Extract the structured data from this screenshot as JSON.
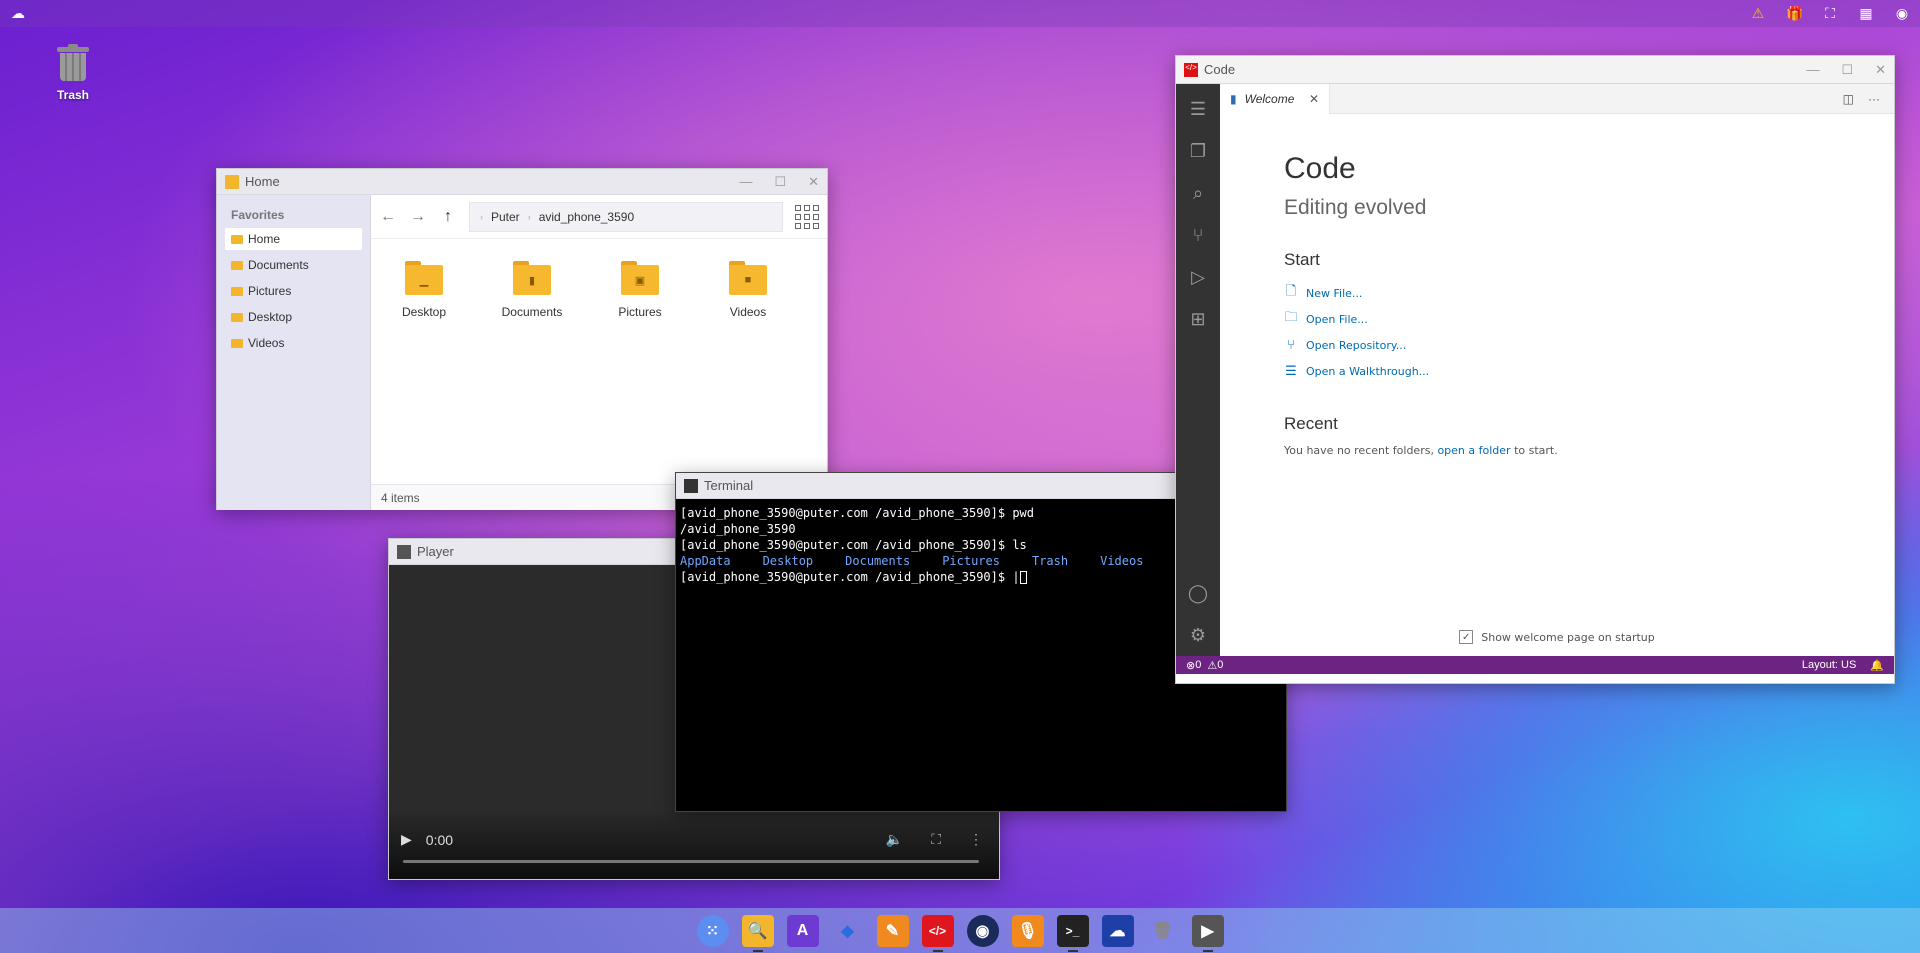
{
  "topbar": {
    "icons": [
      "puter-logo-icon",
      "warning-icon",
      "gift-icon",
      "fullscreen-icon",
      "qr-icon",
      "user-icon"
    ]
  },
  "desktop": {
    "trash_label": "Trash"
  },
  "home": {
    "title": "Home",
    "favorites_heading": "Favorites",
    "sidebar": [
      {
        "label": "Home"
      },
      {
        "label": "Documents"
      },
      {
        "label": "Pictures"
      },
      {
        "label": "Desktop"
      },
      {
        "label": "Videos"
      }
    ],
    "path": [
      "Puter",
      "avid_phone_3590"
    ],
    "files": [
      {
        "label": "Desktop"
      },
      {
        "label": "Documents"
      },
      {
        "label": "Pictures"
      },
      {
        "label": "Videos"
      }
    ],
    "status": "4 items"
  },
  "player": {
    "title": "Player",
    "time": "0:00",
    "progress": 0
  },
  "terminal": {
    "title": "Terminal",
    "lines": [
      "[avid_phone_3590@puter.com /avid_phone_3590]$ pwd",
      "/avid_phone_3590",
      "[avid_phone_3590@puter.com /avid_phone_3590]$ ls"
    ],
    "ls_items": [
      "AppData",
      "Desktop",
      "Documents",
      "Pictures",
      "Trash",
      "Videos"
    ],
    "prompt": "[avid_phone_3590@puter.com /avid_phone_3590]$ |"
  },
  "code": {
    "title": "Code",
    "tab": "Welcome",
    "heading": "Code",
    "subheading": "Editing evolved",
    "start_heading": "Start",
    "start_links": [
      {
        "label": "New File..."
      },
      {
        "label": "Open File..."
      },
      {
        "label": "Open Repository..."
      },
      {
        "label": "Open a Walkthrough..."
      }
    ],
    "recent_heading": "Recent",
    "recent_pre": "You have no recent folders,",
    "recent_link": "open a folder",
    "recent_post": "to start.",
    "show_welcome": "Show welcome page on startup",
    "status_left": "0",
    "status_warn": "0",
    "status_layout": "Layout: US"
  },
  "dock": {
    "apps": [
      "apps-grid",
      "files",
      "text-editor",
      "blocks",
      "paint",
      "code",
      "camera",
      "recorder",
      "terminal",
      "puter",
      "trash",
      "player"
    ]
  }
}
